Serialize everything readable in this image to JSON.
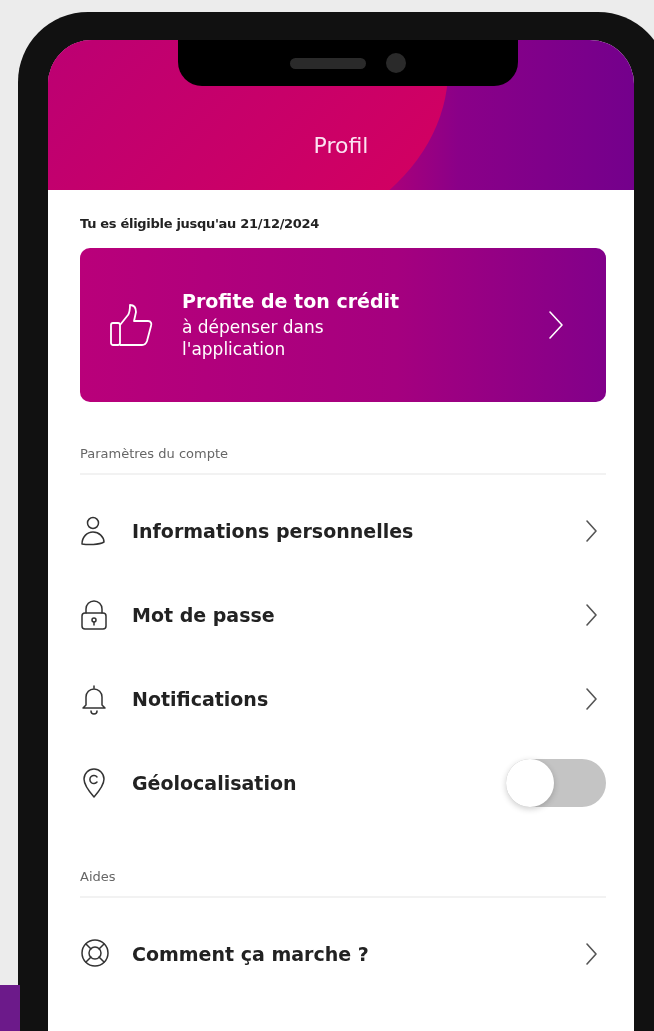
{
  "screen": {
    "title": "Profil"
  },
  "eligibility": "Tu es éligible jusqu'au 21/12/2024",
  "credit_card": {
    "title": "Profite de ton crédit",
    "subtitle": "à dépenser dans l'application"
  },
  "sections": [
    {
      "heading": "Paramètres du compte",
      "items": [
        {
          "kind": "link",
          "label": "Informations personnelles"
        },
        {
          "kind": "link",
          "label": "Mot de passe"
        },
        {
          "kind": "link",
          "label": "Notifications"
        },
        {
          "kind": "toggle",
          "label": "Géolocalisation",
          "on": false
        }
      ]
    },
    {
      "heading": "Aides",
      "items": [
        {
          "kind": "link",
          "label": "Comment ça marche ?"
        }
      ]
    }
  ]
}
